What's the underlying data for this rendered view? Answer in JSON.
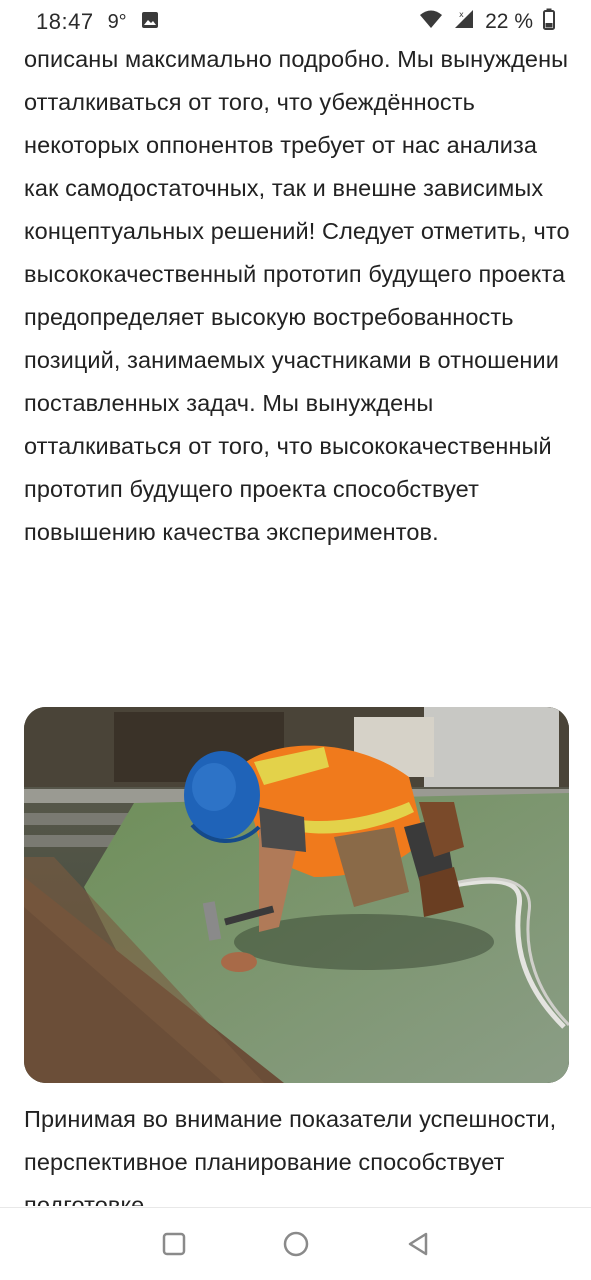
{
  "status_bar": {
    "time": "18:47",
    "temperature": "9°",
    "battery": "22 %",
    "icons": [
      "image-icon",
      "wifi-icon",
      "signal-icon",
      "battery-icon"
    ]
  },
  "article": {
    "paragraph_top": "описаны максимально подробно. Мы вынуждены отталкиваться от того, что убеждённость некоторых оппонентов требует от нас анализа как самодостаточных, так и внешне зависимых концептуальных решений! Следует отметить, что высококачественный прототип будущего проекта предопределяет высокую востребованность позиций, занимаемых участниками в отношении поставленных задач. Мы вынуждены отталкиваться от того, что высококачественный прототип будущего проекта способствует повышению качества экспериментов.",
    "paragraph_bottom": "Принимая во внимание показатели успешности, перспективное планирование способствует подготовке"
  },
  "nav_bar": {
    "buttons": [
      "recent-apps",
      "home",
      "back"
    ]
  },
  "colors": {
    "text": "#222222",
    "background": "#ffffff",
    "nav_icon": "#8a8a8a"
  }
}
